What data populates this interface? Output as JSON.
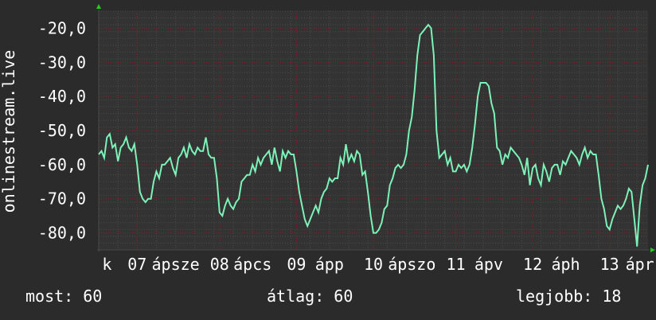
{
  "colors": {
    "background": "#2b2b2b",
    "plot_background": "#333333",
    "grid_major": "#8a2020",
    "grid_minor": "#4a4a4a",
    "line": "#7cf2b8",
    "axis_arrow": "#22cc22",
    "text": "#ffffff"
  },
  "stats": {
    "now": "most: 60",
    "avg": "átlag: 60",
    "best": "legjobb: 18"
  },
  "chart_data": {
    "type": "line",
    "ylabel": "onlinestream.live",
    "ylim": [
      -85,
      -15
    ],
    "yticks": [
      -80,
      -70,
      -60,
      -50,
      -40,
      -30,
      -20
    ],
    "ytick_labels": [
      "-80,0",
      "-70,0",
      "-60,0",
      "-50,0",
      "-40,0",
      "-30,0",
      "-20,0"
    ],
    "xlim": [
      0,
      100
    ],
    "x_tick_labels": [
      {
        "x": 1.5,
        "label": "k"
      },
      {
        "x": 7,
        "label": "07"
      },
      {
        "x": 14,
        "label": "ápsze"
      },
      {
        "x": 22,
        "label": "08"
      },
      {
        "x": 28,
        "label": "ápcs"
      },
      {
        "x": 36,
        "label": "09"
      },
      {
        "x": 42,
        "label": "ápp"
      },
      {
        "x": 50,
        "label": "10"
      },
      {
        "x": 57,
        "label": "ápszo"
      },
      {
        "x": 65,
        "label": "11"
      },
      {
        "x": 71,
        "label": "ápv"
      },
      {
        "x": 79,
        "label": "12"
      },
      {
        "x": 85,
        "label": "áph"
      },
      {
        "x": 93,
        "label": "13"
      },
      {
        "x": 98.5,
        "label": "ápr"
      }
    ],
    "grid": true,
    "series": [
      {
        "values": [
          [
            0,
            -57
          ],
          [
            0.5,
            -56
          ],
          [
            1,
            -58
          ],
          [
            1.5,
            -52
          ],
          [
            2,
            -51
          ],
          [
            2.5,
            -55
          ],
          [
            3,
            -54
          ],
          [
            3.5,
            -59
          ],
          [
            4,
            -55
          ],
          [
            4.5,
            -54
          ],
          [
            5,
            -52
          ],
          [
            5.5,
            -55
          ],
          [
            6,
            -56
          ],
          [
            6.5,
            -54
          ],
          [
            7,
            -60
          ],
          [
            7.5,
            -68
          ],
          [
            8,
            -70
          ],
          [
            8.5,
            -71
          ],
          [
            9,
            -70
          ],
          [
            9.5,
            -70
          ],
          [
            10,
            -65
          ],
          [
            10.5,
            -62
          ],
          [
            11,
            -64
          ],
          [
            11.5,
            -60
          ],
          [
            12,
            -60
          ],
          [
            12.5,
            -59
          ],
          [
            13,
            -58
          ],
          [
            13.5,
            -61
          ],
          [
            14,
            -63
          ],
          [
            14.5,
            -58
          ],
          [
            15,
            -57
          ],
          [
            15.5,
            -55
          ],
          [
            16,
            -58
          ],
          [
            16.5,
            -54
          ],
          [
            17,
            -56
          ],
          [
            17.5,
            -57
          ],
          [
            18,
            -55
          ],
          [
            18.5,
            -56
          ],
          [
            19,
            -56
          ],
          [
            19.5,
            -52
          ],
          [
            20,
            -57
          ],
          [
            20.5,
            -58
          ],
          [
            21,
            -58
          ],
          [
            21.5,
            -64
          ],
          [
            22,
            -74
          ],
          [
            22.5,
            -75
          ],
          [
            23,
            -72
          ],
          [
            23.5,
            -70
          ],
          [
            24,
            -72
          ],
          [
            24.5,
            -73
          ],
          [
            25,
            -71
          ],
          [
            25.5,
            -70
          ],
          [
            26,
            -65
          ],
          [
            26.5,
            -64
          ],
          [
            27,
            -63
          ],
          [
            27.5,
            -63
          ],
          [
            28,
            -60
          ],
          [
            28.5,
            -62
          ],
          [
            29,
            -58
          ],
          [
            29.5,
            -60
          ],
          [
            30,
            -58
          ],
          [
            30.5,
            -57
          ],
          [
            31,
            -56
          ],
          [
            31.5,
            -60
          ],
          [
            32,
            -55
          ],
          [
            32.5,
            -59
          ],
          [
            33,
            -62
          ],
          [
            33.5,
            -56
          ],
          [
            34,
            -58
          ],
          [
            34.5,
            -56
          ],
          [
            35,
            -57
          ],
          [
            35.5,
            -57
          ],
          [
            36,
            -62
          ],
          [
            36.5,
            -68
          ],
          [
            37,
            -72
          ],
          [
            37.5,
            -76
          ],
          [
            38,
            -78
          ],
          [
            38.5,
            -76
          ],
          [
            39,
            -74
          ],
          [
            39.5,
            -72
          ],
          [
            40,
            -74
          ],
          [
            40.5,
            -70
          ],
          [
            41,
            -68
          ],
          [
            41.5,
            -67
          ],
          [
            42,
            -64
          ],
          [
            42.5,
            -65
          ],
          [
            43,
            -64
          ],
          [
            43.5,
            -64
          ],
          [
            44,
            -58
          ],
          [
            44.5,
            -60
          ],
          [
            45,
            -54
          ],
          [
            45.5,
            -59
          ],
          [
            46,
            -57
          ],
          [
            46.5,
            -59
          ],
          [
            47,
            -56
          ],
          [
            47.5,
            -57
          ],
          [
            48,
            -63
          ],
          [
            48.5,
            -62
          ],
          [
            49,
            -68
          ],
          [
            49.5,
            -75
          ],
          [
            50,
            -80
          ],
          [
            50.5,
            -80
          ],
          [
            51,
            -79
          ],
          [
            51.5,
            -77
          ],
          [
            52,
            -73
          ],
          [
            52.5,
            -72
          ],
          [
            53,
            -66
          ],
          [
            53.5,
            -64
          ],
          [
            54,
            -61
          ],
          [
            54.5,
            -60
          ],
          [
            55,
            -61
          ],
          [
            55.5,
            -60
          ],
          [
            56,
            -57
          ],
          [
            56.5,
            -50
          ],
          [
            57,
            -46
          ],
          [
            57.5,
            -38
          ],
          [
            58,
            -28
          ],
          [
            58.5,
            -22
          ],
          [
            59,
            -21
          ],
          [
            59.5,
            -20
          ],
          [
            60,
            -19
          ],
          [
            60.5,
            -20
          ],
          [
            61,
            -28
          ],
          [
            61.5,
            -50
          ],
          [
            62,
            -58
          ],
          [
            62.5,
            -57
          ],
          [
            63,
            -56
          ],
          [
            63.5,
            -60
          ],
          [
            64,
            -58
          ],
          [
            64.5,
            -62
          ],
          [
            65,
            -62
          ],
          [
            65.5,
            -60
          ],
          [
            66,
            -61
          ],
          [
            66.5,
            -60
          ],
          [
            67,
            -62
          ],
          [
            67.5,
            -60
          ],
          [
            68,
            -55
          ],
          [
            68.5,
            -48
          ],
          [
            69,
            -40
          ],
          [
            69.5,
            -36
          ],
          [
            70,
            -36
          ],
          [
            70.5,
            -36
          ],
          [
            71,
            -37
          ],
          [
            71.5,
            -42
          ],
          [
            72,
            -45
          ],
          [
            72.5,
            -55
          ],
          [
            73,
            -56
          ],
          [
            73.5,
            -60
          ],
          [
            74,
            -57
          ],
          [
            74.5,
            -58
          ],
          [
            75,
            -55
          ],
          [
            75.5,
            -56
          ],
          [
            76,
            -57
          ],
          [
            76.5,
            -58
          ],
          [
            77,
            -60
          ],
          [
            77.5,
            -63
          ],
          [
            78,
            -58
          ],
          [
            78.5,
            -66
          ],
          [
            79,
            -61
          ],
          [
            79.5,
            -60
          ],
          [
            80,
            -64
          ],
          [
            80.5,
            -66
          ],
          [
            81,
            -60
          ],
          [
            81.5,
            -62
          ],
          [
            82,
            -65
          ],
          [
            82.5,
            -61
          ],
          [
            83,
            -60
          ],
          [
            83.5,
            -60
          ],
          [
            84,
            -63
          ],
          [
            84.5,
            -59
          ],
          [
            85,
            -60
          ],
          [
            85.5,
            -58
          ],
          [
            86,
            -56
          ],
          [
            86.5,
            -57
          ],
          [
            87,
            -58
          ],
          [
            87.5,
            -60
          ],
          [
            88,
            -57
          ],
          [
            88.5,
            -55
          ],
          [
            89,
            -58
          ],
          [
            89.5,
            -56
          ],
          [
            90,
            -57
          ],
          [
            90.5,
            -57
          ],
          [
            91,
            -63
          ],
          [
            91.5,
            -70
          ],
          [
            92,
            -73
          ],
          [
            92.5,
            -78
          ],
          [
            93,
            -79
          ],
          [
            93.5,
            -76
          ],
          [
            94,
            -74
          ],
          [
            94.5,
            -72
          ],
          [
            95,
            -73
          ],
          [
            95.5,
            -72
          ],
          [
            96,
            -70
          ],
          [
            96.5,
            -67
          ],
          [
            97,
            -68
          ],
          [
            97.5,
            -76
          ],
          [
            98,
            -84
          ],
          [
            98.5,
            -72
          ],
          [
            99,
            -66
          ],
          [
            99.5,
            -64
          ],
          [
            100,
            -60
          ]
        ]
      }
    ]
  }
}
